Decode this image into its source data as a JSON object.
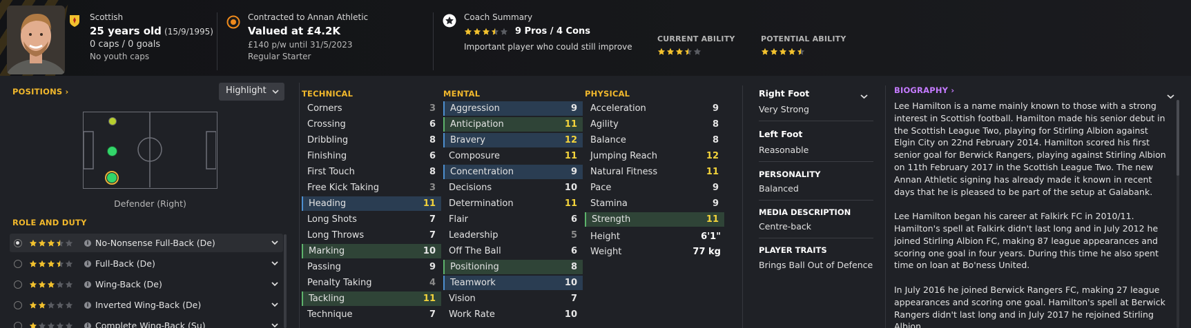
{
  "header": {
    "nationality": "Scottish",
    "age": "25 years old",
    "dob": "(15/9/1995)",
    "caps": "0 caps / 0 goals",
    "youth_caps": "No youth caps",
    "contract": "Contracted to Annan Athletic",
    "value": "Valued at £4.2K",
    "wage": "£140 p/w until 31/5/2023",
    "status": "Regular Starter",
    "coach_title": "Coach Summary",
    "coach_pros_cons": "9 Pros / 4 Cons",
    "coach_rating": 3.5,
    "coach_note": "Important player who could still improve",
    "current_ability_label": "CURRENT ABILITY",
    "current_ability": 3.5,
    "potential_ability_label": "POTENTIAL ABILITY",
    "potential_ability": 4.5
  },
  "positions": {
    "title": "POSITIONS",
    "highlight_label": "Highlight",
    "selected_position": "Defender (Right)"
  },
  "roles": {
    "title": "ROLE AND DUTY",
    "items": [
      {
        "label": "No-Nonsense Full-Back (De)",
        "stars": 3.5,
        "active": true
      },
      {
        "label": "Full-Back (De)",
        "stars": 3.5,
        "active": false
      },
      {
        "label": "Wing-Back (De)",
        "stars": 3,
        "active": false
      },
      {
        "label": "Inverted Wing-Back (De)",
        "stars": 2,
        "active": false
      },
      {
        "label": "Complete Wing-Back (Su)",
        "stars": 1,
        "active": false
      }
    ]
  },
  "technical": {
    "title": "TECHNICAL",
    "items": [
      {
        "name": "Corners",
        "value": "3",
        "hl": ""
      },
      {
        "name": "Crossing",
        "value": "6",
        "hl": ""
      },
      {
        "name": "Dribbling",
        "value": "8",
        "hl": ""
      },
      {
        "name": "Finishing",
        "value": "6",
        "hl": ""
      },
      {
        "name": "First Touch",
        "value": "8",
        "hl": ""
      },
      {
        "name": "Free Kick Taking",
        "value": "3",
        "hl": ""
      },
      {
        "name": "Heading",
        "value": "11",
        "hl": "blue"
      },
      {
        "name": "Long Shots",
        "value": "7",
        "hl": ""
      },
      {
        "name": "Long Throws",
        "value": "7",
        "hl": ""
      },
      {
        "name": "Marking",
        "value": "10",
        "hl": "green"
      },
      {
        "name": "Passing",
        "value": "9",
        "hl": ""
      },
      {
        "name": "Penalty Taking",
        "value": "4",
        "hl": ""
      },
      {
        "name": "Tackling",
        "value": "11",
        "hl": "green"
      },
      {
        "name": "Technique",
        "value": "7",
        "hl": ""
      }
    ]
  },
  "mental": {
    "title": "MENTAL",
    "items": [
      {
        "name": "Aggression",
        "value": "9",
        "hl": "blue"
      },
      {
        "name": "Anticipation",
        "value": "11",
        "hl": "green"
      },
      {
        "name": "Bravery",
        "value": "12",
        "hl": "blue"
      },
      {
        "name": "Composure",
        "value": "11",
        "hl": ""
      },
      {
        "name": "Concentration",
        "value": "9",
        "hl": "blue"
      },
      {
        "name": "Decisions",
        "value": "10",
        "hl": ""
      },
      {
        "name": "Determination",
        "value": "11",
        "hl": ""
      },
      {
        "name": "Flair",
        "value": "6",
        "hl": ""
      },
      {
        "name": "Leadership",
        "value": "5",
        "hl": ""
      },
      {
        "name": "Off The Ball",
        "value": "6",
        "hl": ""
      },
      {
        "name": "Positioning",
        "value": "8",
        "hl": "green"
      },
      {
        "name": "Teamwork",
        "value": "10",
        "hl": "blue"
      },
      {
        "name": "Vision",
        "value": "7",
        "hl": ""
      },
      {
        "name": "Work Rate",
        "value": "10",
        "hl": ""
      }
    ]
  },
  "physical": {
    "title": "PHYSICAL",
    "items": [
      {
        "name": "Acceleration",
        "value": "9",
        "hl": ""
      },
      {
        "name": "Agility",
        "value": "8",
        "hl": ""
      },
      {
        "name": "Balance",
        "value": "8",
        "hl": ""
      },
      {
        "name": "Jumping Reach",
        "value": "12",
        "hl": ""
      },
      {
        "name": "Natural Fitness",
        "value": "11",
        "hl": ""
      },
      {
        "name": "Pace",
        "value": "9",
        "hl": ""
      },
      {
        "name": "Stamina",
        "value": "9",
        "hl": ""
      },
      {
        "name": "Strength",
        "value": "11",
        "hl": "green"
      }
    ],
    "height_label": "Height",
    "height": "6'1\"",
    "weight_label": "Weight",
    "weight": "77 kg"
  },
  "details": {
    "right_foot_label": "Right Foot",
    "right_foot": "Very Strong",
    "left_foot_label": "Left Foot",
    "left_foot": "Reasonable",
    "personality_label": "PERSONALITY",
    "personality": "Balanced",
    "media_label": "MEDIA DESCRIPTION",
    "media": "Centre-back",
    "traits_label": "PLAYER TRAITS",
    "traits": "Brings Ball Out of Defence"
  },
  "biography": {
    "title": "BIOGRAPHY",
    "paragraphs": [
      "Lee Hamilton is a name mainly known to those with a strong interest in Scottish football. Hamilton made his senior debut in the Scottish League Two, playing for Stirling Albion against Elgin City on 22nd February 2014. Hamilton scored his first senior goal for Berwick Rangers, playing against Stirling Albion on 11th February 2017 in the Scottish League Two. The new Annan Athletic signing has already made it known in recent days that he is pleased to be part of the setup at Galabank.",
      "Lee Hamilton began his career at Falkirk FC in 2010/11. Hamilton's spell at Falkirk didn't last long and in July 2012 he joined Stirling Albion FC, making 87 league appearances and scoring one goal in four years. During this time he also spent time on loan at Bo'ness United.",
      "In July 2016 he joined Berwick Rangers FC, making 27 league appearances and scoring one goal. Hamilton's spell at Berwick Rangers didn't last long and in July 2017 he rejoined Stirling Albion,"
    ]
  },
  "colors": {
    "accent": "#f0b72c",
    "bio_accent": "#c57bff",
    "star": "#f2c12e",
    "pitch_dot": "#32d66a"
  }
}
